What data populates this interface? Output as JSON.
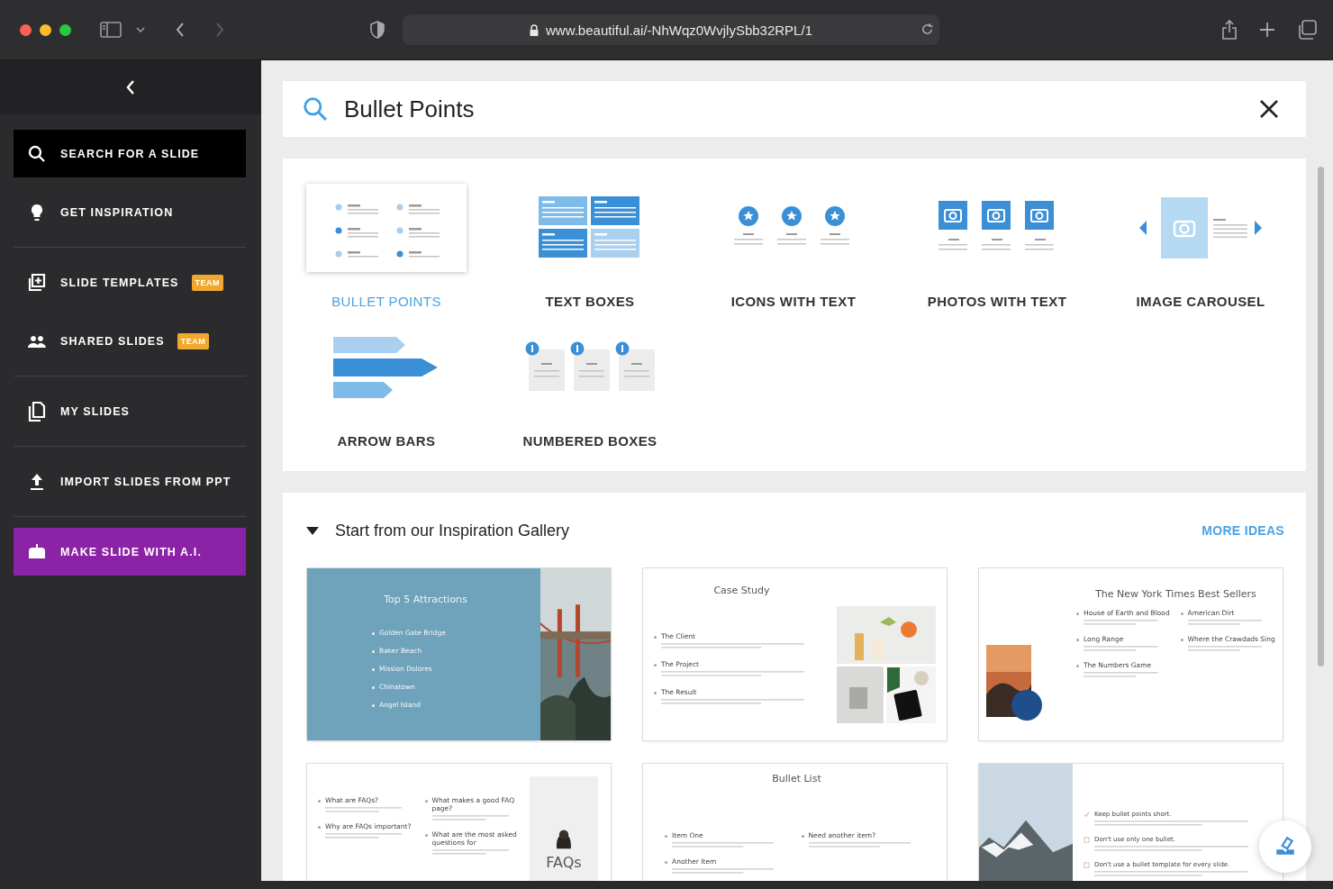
{
  "browser": {
    "url": "www.beautiful.ai/-NhWqz0WvjlySbb32RPL/1"
  },
  "sidebar": {
    "items": [
      {
        "label": "SEARCH FOR A SLIDE",
        "kind": "search",
        "selected": true
      },
      {
        "label": "GET INSPIRATION",
        "kind": "inspiration",
        "selected": false
      },
      {
        "label": "SLIDE TEMPLATES",
        "kind": "templates",
        "selected": false,
        "badge": "TEAM"
      },
      {
        "label": "SHARED SLIDES",
        "kind": "shared",
        "selected": false,
        "badge": "TEAM"
      },
      {
        "label": "MY SLIDES",
        "kind": "mine",
        "selected": false
      },
      {
        "label": "IMPORT SLIDES FROM PPT",
        "kind": "import",
        "selected": false
      },
      {
        "label": "MAKE SLIDE WITH A.I.",
        "kind": "ai",
        "selected": false
      }
    ]
  },
  "search": {
    "value": "Bullet Points"
  },
  "templates": [
    {
      "label": "BULLET POINTS",
      "kind": "bullets",
      "selected": true
    },
    {
      "label": "TEXT BOXES",
      "kind": "textboxes",
      "selected": false
    },
    {
      "label": "ICONS WITH TEXT",
      "kind": "icons",
      "selected": false
    },
    {
      "label": "PHOTOS WITH TEXT",
      "kind": "photos",
      "selected": false
    },
    {
      "label": "IMAGE CAROUSEL",
      "kind": "carousel",
      "selected": false
    },
    {
      "label": "ARROW BARS",
      "kind": "arrows",
      "selected": false
    },
    {
      "label": "NUMBERED BOXES",
      "kind": "numbered",
      "selected": false
    }
  ],
  "gallery": {
    "title": "Start from our Inspiration Gallery",
    "expanded": true,
    "more_link": "MORE IDEAS",
    "slides": [
      {
        "kind": "teal-photo-right",
        "title": "Top 5 Attractions",
        "columns": [
          [
            {
              "text": "Golden Gate Bridge"
            },
            {
              "text": "Baker Beach"
            },
            {
              "text": "Mission Dolores"
            },
            {
              "text": "Chinatown"
            },
            {
              "text": "Angel Island"
            }
          ]
        ]
      },
      {
        "kind": "photo-right",
        "title": "Case Study",
        "columns": [
          [
            {
              "text": "The Client"
            },
            {
              "text": "The Project"
            },
            {
              "text": "The Result"
            }
          ]
        ]
      },
      {
        "kind": "photo-left",
        "title": "The New York Times Best Sellers",
        "columns": [
          [
            {
              "text": "House of Earth and Blood"
            },
            {
              "text": "Long Range"
            },
            {
              "text": "The Numbers Game"
            }
          ],
          [
            {
              "text": "American Dirt"
            },
            {
              "text": "Where the Crawdads Sing"
            }
          ]
        ]
      },
      {
        "kind": "panel-right",
        "panel_text": "FAQs",
        "columns": [
          [
            {
              "text": "What are FAQs?"
            },
            {
              "text": "Why are FAQs important?"
            }
          ],
          [
            {
              "text": "What makes a good FAQ page?"
            },
            {
              "text": "What are the most asked questions for"
            }
          ]
        ]
      },
      {
        "kind": "plain",
        "title": "Bullet List",
        "columns": [
          [
            {
              "text": "Item One"
            },
            {
              "text": "Another Item"
            }
          ],
          [
            {
              "text": "Need another item?"
            }
          ]
        ]
      },
      {
        "kind": "photo-left-checklist",
        "columns": [
          [
            {
              "text": "Keep bullet points short.",
              "kind": "do"
            },
            {
              "text": "Don't use only one bullet.",
              "kind": "dont"
            },
            {
              "text": "Don't use a bullet template for every slide.",
              "kind": "dont"
            }
          ]
        ]
      }
    ]
  }
}
